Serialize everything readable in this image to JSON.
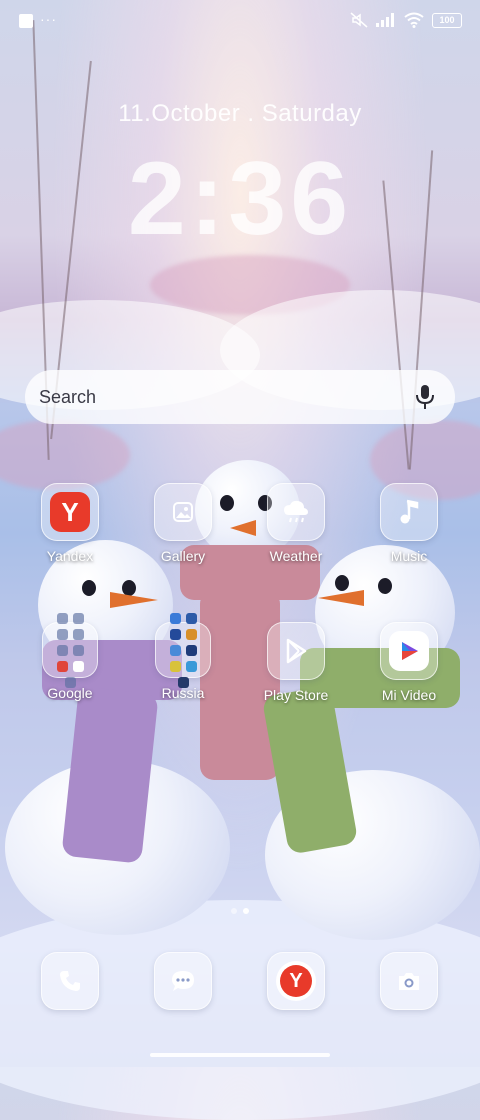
{
  "status_bar": {
    "battery": "100",
    "icons": [
      "notification-square-icon",
      "more-dots-icon",
      "mute-icon",
      "signal-icon",
      "wifi-icon",
      "battery-icon"
    ]
  },
  "lock": {
    "date": "11.October . Saturday",
    "time": "2:36"
  },
  "search": {
    "placeholder": "Search"
  },
  "apps": [
    {
      "label": "Yandex",
      "icon": "yandex-icon"
    },
    {
      "label": "Gallery",
      "icon": "gallery-icon"
    },
    {
      "label": "Weather",
      "icon": "weather-icon"
    },
    {
      "label": "Music",
      "icon": "music-icon"
    },
    {
      "label": "Google",
      "icon": "folder-icon"
    },
    {
      "label": "Russia",
      "icon": "folder-icon"
    },
    {
      "label": "Play Store",
      "icon": "play-store-icon"
    },
    {
      "label": "Mi Video",
      "icon": "mi-video-icon"
    }
  ],
  "dock": [
    {
      "icon": "phone-icon"
    },
    {
      "icon": "messages-icon"
    },
    {
      "icon": "yandex-browser-icon"
    },
    {
      "icon": "camera-icon"
    }
  ],
  "pager": {
    "pages": 2,
    "current": 2
  },
  "colors": {
    "yandex_red": "#e83a2a",
    "icon_glass": "rgba(255,255,255,0.32)"
  }
}
